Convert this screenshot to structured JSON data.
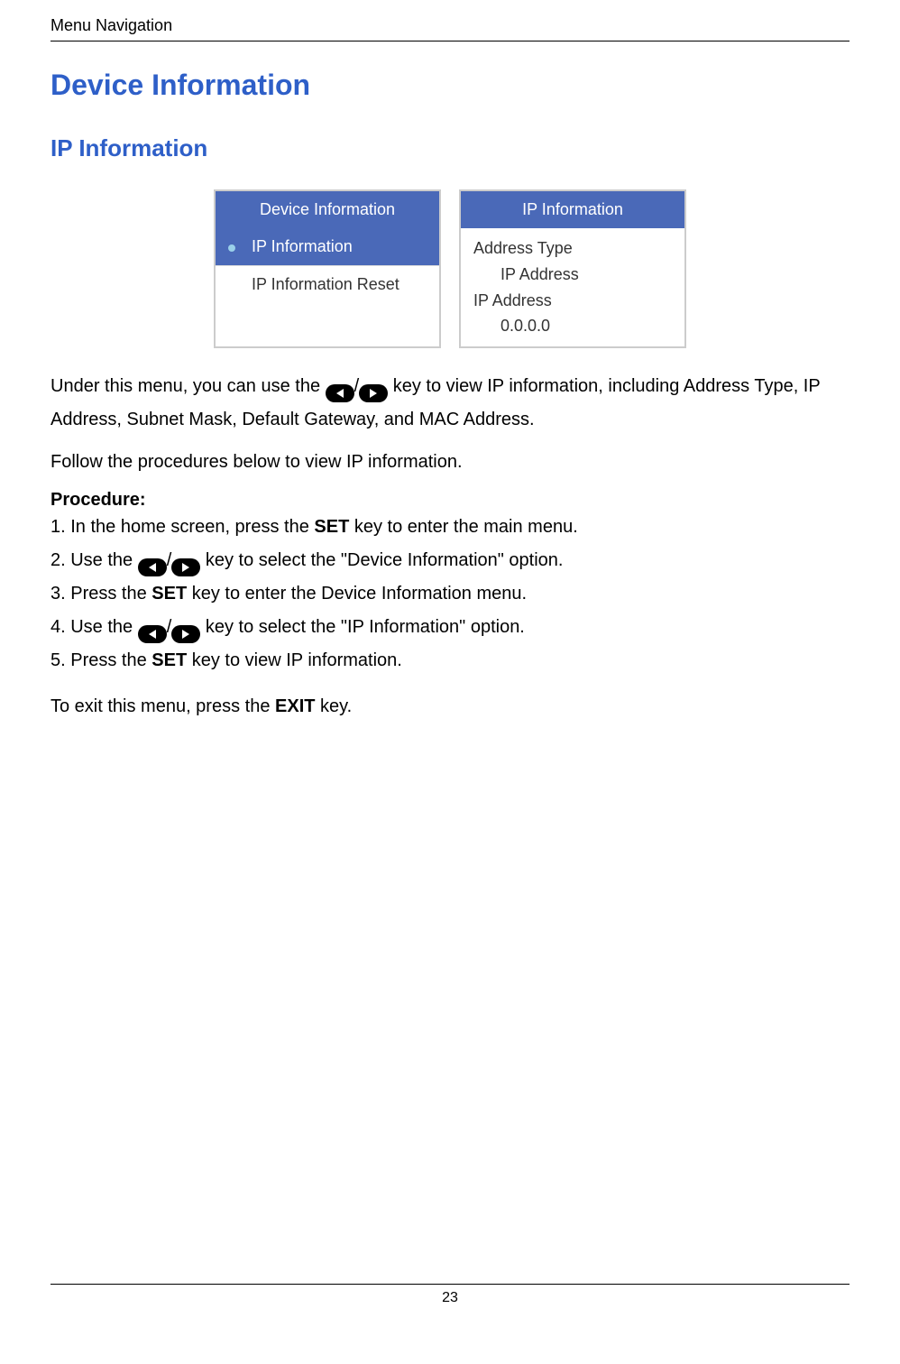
{
  "header": {
    "breadcrumb": "Menu Navigation",
    "h1": "Device Information",
    "h2": "IP Information"
  },
  "panels": {
    "left": {
      "title": "Device Information",
      "row1": "IP Information",
      "row2": "IP Information Reset"
    },
    "right": {
      "title": "IP Information",
      "field1_label": "Address Type",
      "field1_value": "IP Address",
      "field2_label": "IP Address",
      "field2_value": "0.0.0.0"
    }
  },
  "body": {
    "para1_a": "Under this menu, you can use the ",
    "para1_b": " key to view IP information, including Address Type, IP Address, Subnet Mask, Default Gateway, and MAC Address.",
    "para2": "Follow the procedures below to view IP information.",
    "proc_heading": "Procedure:",
    "step1_a": "1. In the home screen, press the ",
    "step1_bold": "SET",
    "step1_b": " key to enter the main menu.",
    "step2_a": "2. Use the ",
    "step2_b": " key to select the \"Device Information\" option.",
    "step3_a": "3. Press the ",
    "step3_bold": "SET",
    "step3_b": " key to enter the Device Information menu.",
    "step4_a": "4. Use the ",
    "step4_b": " key to select the \"IP Information\" option.",
    "step5_a": "5. Press the ",
    "step5_bold": "SET",
    "step5_b": " key to view IP information.",
    "exit_a": "To exit this menu, press the ",
    "exit_bold": "EXIT",
    "exit_b": " key."
  },
  "footer": {
    "page_number": "23"
  },
  "icons": {
    "nav_left": "nav-left-key-icon",
    "nav_right": "nav-right-key-icon",
    "slash": "/"
  }
}
